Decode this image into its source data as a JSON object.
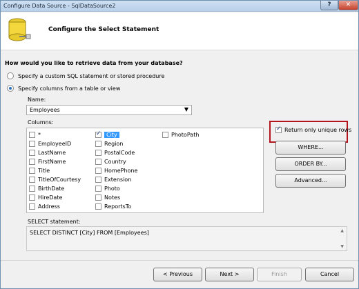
{
  "window": {
    "title": "Configure Data Source - SqlDataSource2",
    "help_button": "?",
    "close_button": "✕"
  },
  "header": {
    "title": "Configure the Select Statement"
  },
  "question": "How would you like to retrieve data from your database?",
  "options": {
    "custom_sql": "Specify a custom SQL statement or stored procedure",
    "columns": "Specify columns from a table or view"
  },
  "name_section": {
    "label": "Name:",
    "selected": "Employees",
    "dropdown_icon": "▼"
  },
  "columns_section": {
    "label": "Columns:",
    "items": [
      {
        "label": "*",
        "checked": false
      },
      {
        "label": "EmployeeID",
        "checked": false
      },
      {
        "label": "LastName",
        "checked": false
      },
      {
        "label": "FirstName",
        "checked": false
      },
      {
        "label": "Title",
        "checked": false
      },
      {
        "label": "TitleOfCourtesy",
        "checked": false
      },
      {
        "label": "BirthDate",
        "checked": false
      },
      {
        "label": "HireDate",
        "checked": false
      },
      {
        "label": "Address",
        "checked": false
      },
      {
        "label": "City",
        "checked": true,
        "selected": true
      },
      {
        "label": "Region",
        "checked": false
      },
      {
        "label": "PostalCode",
        "checked": false
      },
      {
        "label": "Country",
        "checked": false
      },
      {
        "label": "HomePhone",
        "checked": false
      },
      {
        "label": "Extension",
        "checked": false
      },
      {
        "label": "Photo",
        "checked": false
      },
      {
        "label": "Notes",
        "checked": false
      },
      {
        "label": "ReportsTo",
        "checked": false
      },
      {
        "label": "PhotoPath",
        "checked": false
      }
    ]
  },
  "side": {
    "unique_rows_label": "Return only unique rows",
    "where_button": "WHERE...",
    "orderby_button": "ORDER BY...",
    "advanced_button": "Advanced..."
  },
  "statement": {
    "label": "SELECT statement:",
    "value": "SELECT DISTINCT [City] FROM [Employees]"
  },
  "footer": {
    "previous": "< Previous",
    "next": "Next >",
    "finish": "Finish",
    "cancel": "Cancel"
  }
}
